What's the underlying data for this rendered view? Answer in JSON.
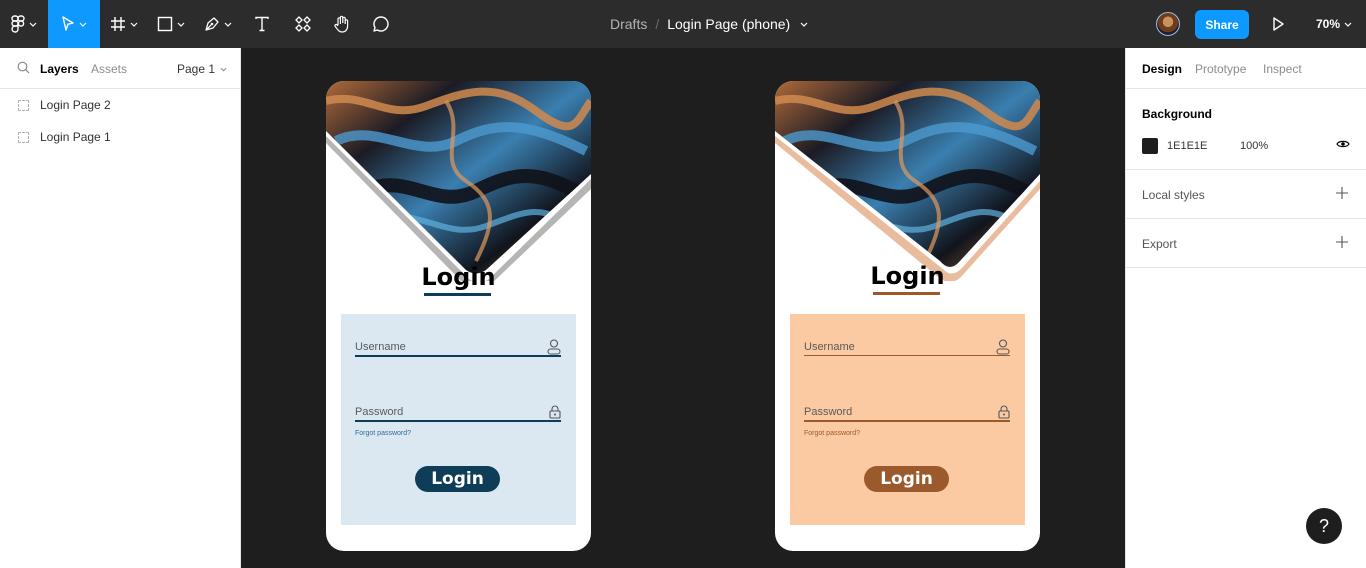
{
  "toolbar": {
    "tools": [
      {
        "name": "main-menu",
        "icon": "figma-logo-icon"
      },
      {
        "name": "move-tool",
        "icon": "cursor-icon",
        "active": true
      },
      {
        "name": "frame-tool",
        "icon": "frame-icon"
      },
      {
        "name": "shape-tool",
        "icon": "rectangle-icon"
      },
      {
        "name": "pen-tool",
        "icon": "pen-icon"
      },
      {
        "name": "text-tool",
        "icon": "text-icon"
      },
      {
        "name": "resources-tool",
        "icon": "components-icon"
      },
      {
        "name": "hand-tool",
        "icon": "hand-icon"
      },
      {
        "name": "comment-tool",
        "icon": "comment-icon"
      }
    ],
    "breadcrumb_parent": "Drafts",
    "breadcrumb_separator": "/",
    "file_name": "Login Page (phone)",
    "share_label": "Share",
    "zoom_label": "70%",
    "accent_color": "#0d99ff"
  },
  "left_panel": {
    "tabs": [
      "Layers",
      "Assets"
    ],
    "active_tab": "Layers",
    "page_label": "Page 1",
    "layers": [
      "Login Page 2",
      "Login Page 1"
    ]
  },
  "canvas": {
    "background": "#1e1e1e",
    "frames": [
      {
        "theme": "blue",
        "title": "Login",
        "username_placeholder": "Username",
        "password_placeholder": "Password",
        "forgot_password": "Forgot password?",
        "button_label": "Login",
        "panel_color": "#dbe8f2",
        "accent_color": "#0f3d57",
        "shadow_color": "#a8a8a8"
      },
      {
        "theme": "peach",
        "title": "Login",
        "username_placeholder": "Username",
        "password_placeholder": "Password",
        "forgot_password": "Forgot password?",
        "button_label": "Login",
        "panel_color": "#fbcaa2",
        "accent_color": "#9a5a2c",
        "shadow_color": "#e8b593"
      }
    ]
  },
  "right_panel": {
    "tabs": [
      "Design",
      "Prototype",
      "Inspect"
    ],
    "active_tab": "Design",
    "background": {
      "heading": "Background",
      "hex": "1E1E1E",
      "opacity": "100%"
    },
    "local_styles": "Local styles",
    "export": "Export"
  },
  "help_label": "?"
}
